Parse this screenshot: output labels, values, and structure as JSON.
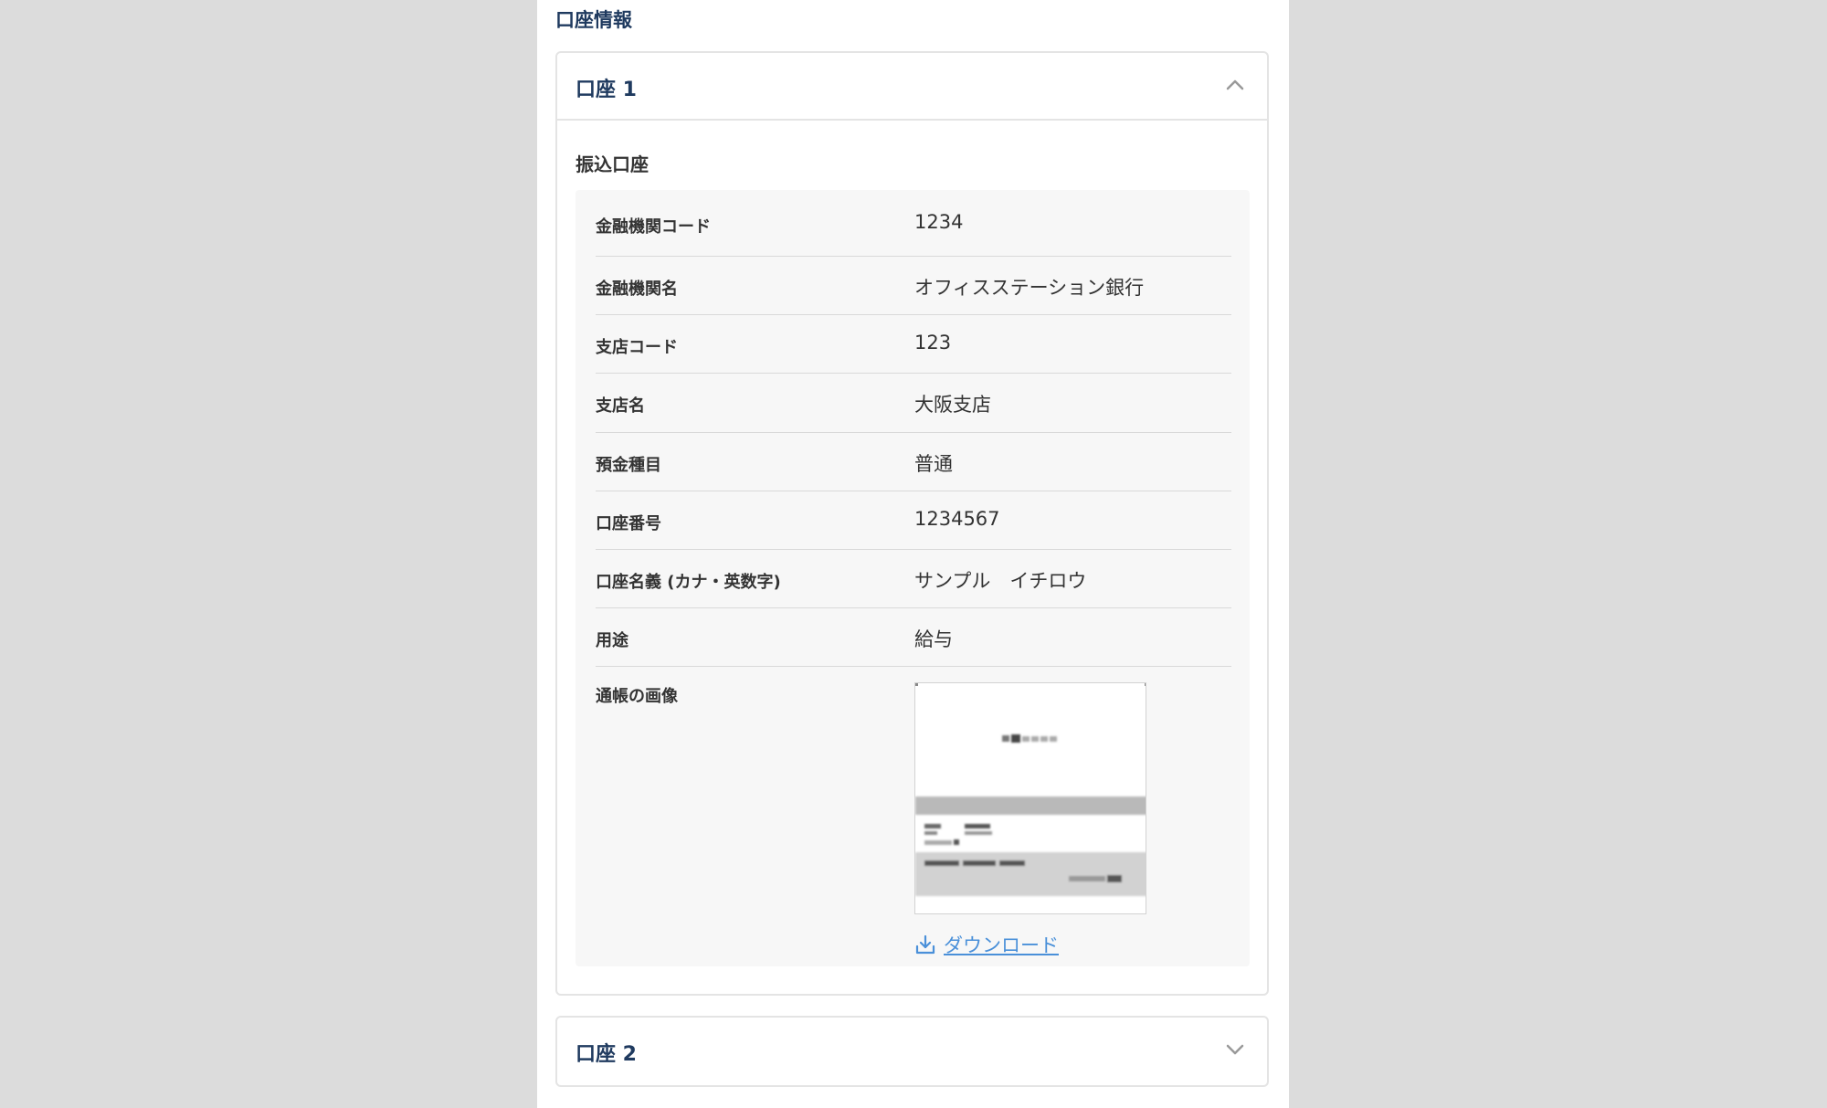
{
  "section_title": "口座情報",
  "accounts": [
    {
      "title": "口座 1",
      "expanded": true,
      "subsection_title": "振込口座",
      "fields": [
        {
          "label": "金融機関コード",
          "value": "1234"
        },
        {
          "label": "金融機関名",
          "value": "オフィスステーション銀行"
        },
        {
          "label": "支店コード",
          "value": "123"
        },
        {
          "label": "支店名",
          "value": "大阪支店"
        },
        {
          "label": "預金種目",
          "value": "普通"
        },
        {
          "label": "口座番号",
          "value": "1234567"
        },
        {
          "label": "口座名義 (カナ・英数字)",
          "value": "サンプル　イチロウ"
        },
        {
          "label": "用途",
          "value": "給与"
        }
      ],
      "passbook": {
        "label": "通帳の画像",
        "download_label": "ダウンロード"
      }
    },
    {
      "title": "口座 2",
      "expanded": false
    }
  ],
  "icons": {
    "collapse": "chevron-up-icon",
    "expand": "chevron-down-icon",
    "download": "download-icon",
    "passbook": "passbook-image"
  },
  "colors": {
    "heading": "#1f3a5f",
    "link": "#4a90d9",
    "panel_bg": "#f7f7f7",
    "outer_bg": "#dcdcdc"
  }
}
